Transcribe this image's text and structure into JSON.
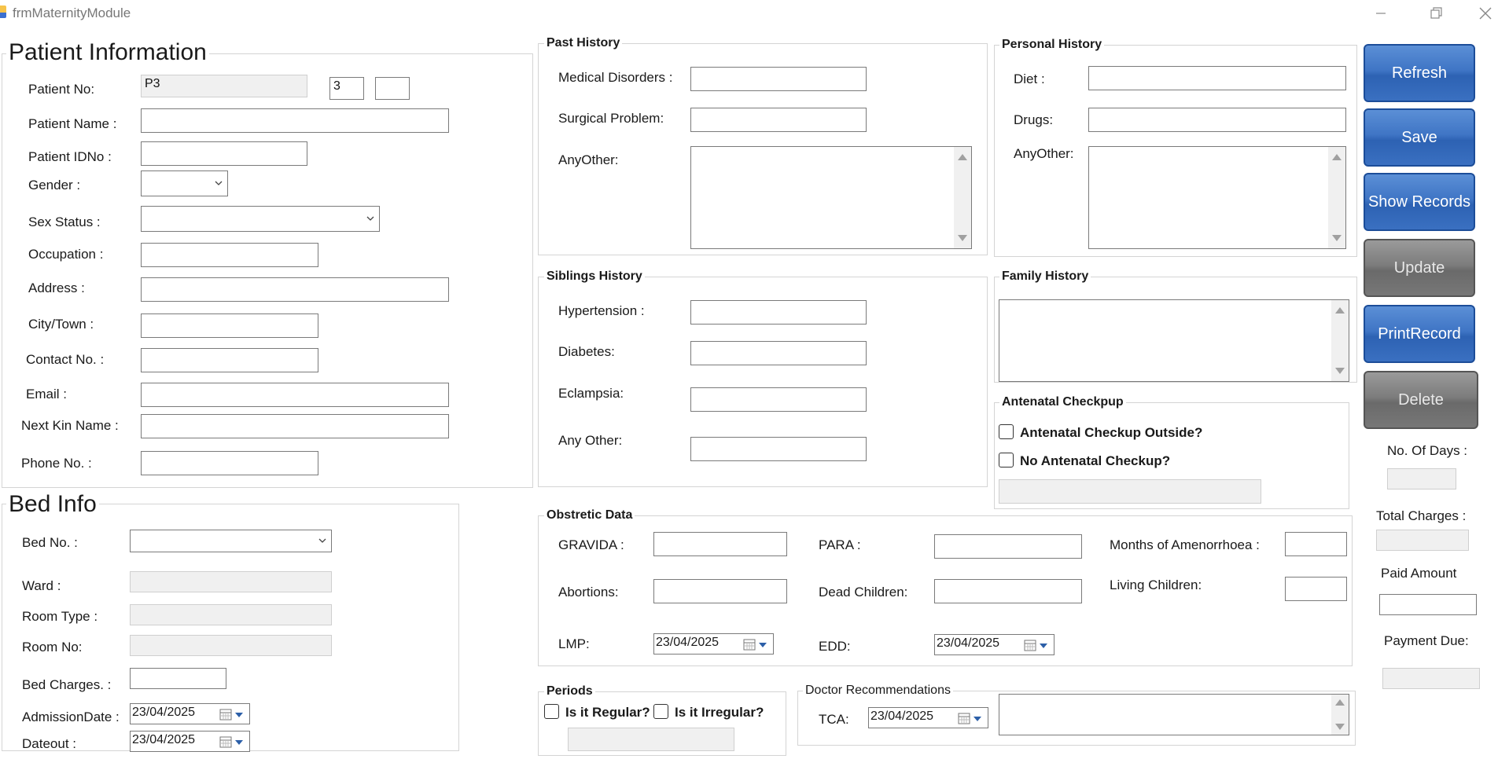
{
  "window": {
    "title": "frmMaternityModule"
  },
  "patient_info": {
    "title": "Patient Information",
    "patient_no_label": "Patient No:",
    "patient_no_value": "P3",
    "patient_no_seq": "3",
    "patient_name_label": "Patient Name :",
    "patient_idno_label": "Patient IDNo :",
    "gender_label": "Gender :",
    "sex_status_label": "Sex Status :",
    "occupation_label": "Occupation :",
    "address_label": "Address :",
    "city_label": "City/Town :",
    "contact_label": "Contact No. :",
    "email_label": "Email :",
    "next_kin_label": "Next Kin Name :",
    "phone_label": "Phone No. :"
  },
  "bed_info": {
    "title": "Bed Info",
    "bed_no_label": "Bed No. :",
    "ward_label": "Ward :",
    "room_type_label": "Room Type :",
    "room_no_label": "Room No:",
    "bed_charges_label": "Bed Charges. :",
    "admission_date_label": "AdmissionDate :",
    "admission_date_value": "23/04/2025",
    "dateout_label": "Dateout :",
    "dateout_value": "23/04/2025"
  },
  "past_history": {
    "title": "Past History",
    "medical_label": "Medical Disorders :",
    "surgical_label": "Surgical Problem:",
    "anyother_label": "AnyOther:"
  },
  "personal_history": {
    "title": "Personal History",
    "diet_label": "Diet :",
    "drugs_label": "Drugs:",
    "anyother_label": "AnyOther:"
  },
  "siblings_history": {
    "title": "Siblings History",
    "hypertension_label": "Hypertension :",
    "diabetes_label": "Diabetes:",
    "eclampsia_label": "Eclampsia:",
    "anyother_label": "Any Other:"
  },
  "family_history": {
    "title": "Family History"
  },
  "antenatal": {
    "title": "Antenatal Checkpup",
    "outside_label": "Antenatal Checkup Outside?",
    "none_label": "No Antenatal Checkup?"
  },
  "obstetric": {
    "title": "Obstretic Data",
    "gravida_label": "GRAVIDA :",
    "para_label": "PARA :",
    "amenorrhoea_label": "Months of Amenorrhoea :",
    "abortions_label": "Abortions:",
    "dead_children_label": "Dead Children:",
    "living_children_label": "Living Children:",
    "lmp_label": "LMP:",
    "lmp_value": "23/04/2025",
    "edd_label": "EDD:",
    "edd_value": "23/04/2025"
  },
  "periods": {
    "title": "Periods",
    "regular_label": "Is it Regular?",
    "irregular_label": "Is it Irregular?"
  },
  "doctor": {
    "title": "Doctor Recommendations",
    "tca_label": "TCA:",
    "tca_value": "23/04/2025"
  },
  "buttons": {
    "refresh": "Refresh",
    "save": "Save",
    "show_records": "Show Records",
    "update": "Update",
    "print_record": "PrintRecord",
    "delete": "Delete"
  },
  "billing": {
    "days_label": "No. Of Days :",
    "total_label": "Total Charges :",
    "paid_label": "Paid Amount",
    "due_label": "Payment Due:"
  }
}
